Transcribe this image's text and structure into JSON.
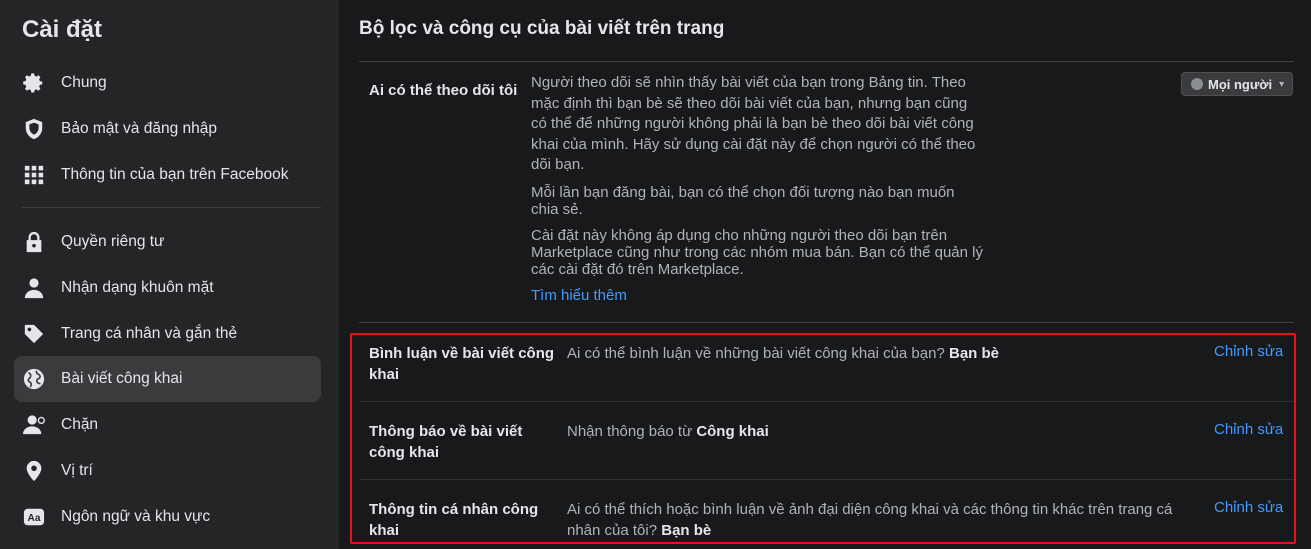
{
  "sidebar": {
    "title": "Cài đặt",
    "items": [
      {
        "label": "Chung",
        "icon": "gear-icon"
      },
      {
        "label": "Bảo mật và đăng nhập",
        "icon": "shield-icon"
      },
      {
        "label": "Thông tin của bạn trên Facebook",
        "icon": "grid-icon"
      },
      {
        "label": "Quyền riêng tư",
        "icon": "lock-icon"
      },
      {
        "label": "Nhận dạng khuôn mặt",
        "icon": "person-icon"
      },
      {
        "label": "Trang cá nhân và gắn thẻ",
        "icon": "tag-icon"
      },
      {
        "label": "Bài viết công khai",
        "icon": "globe-icon",
        "active": true
      },
      {
        "label": "Chặn",
        "icon": "block-person-icon"
      },
      {
        "label": "Vị trí",
        "icon": "location-pin-icon"
      },
      {
        "label": "Ngôn ngữ và khu vực",
        "icon": "language-icon"
      }
    ]
  },
  "main": {
    "title": "Bộ lọc và công cụ của bài viết trên trang",
    "follow": {
      "label": "Ai có thể theo dõi tôi",
      "para1": "Người theo dõi sẽ nhìn thấy bài viết của bạn trong Bảng tin. Theo mặc định thì bạn bè sẽ theo dõi bài viết của bạn, nhưng bạn cũng có thể để những người không phải là bạn bè theo dõi bài viết công khai của mình. Hãy sử dụng cài đặt này để chọn người có thể theo dõi bạn.",
      "para2": "Mỗi lần bạn đăng bài, bạn có thể chọn đối tượng nào bạn muốn chia sẻ.",
      "para3": "Cài đặt này không áp dụng cho những người theo dõi bạn trên Marketplace cũng như trong các nhóm mua bán. Bạn có thể quản lý các cài đặt đó trên Marketplace.",
      "learn_more": "Tìm hiểu thêm",
      "audience": "Mọi người"
    },
    "rows": [
      {
        "label": "Bình luận về bài viết công khai",
        "desc": "Ai có thể bình luận về những bài viết công khai của bạn? ",
        "value": "Bạn bè",
        "edit": "Chỉnh sửa"
      },
      {
        "label": "Thông báo về bài viết công khai",
        "desc": "Nhận thông báo từ ",
        "value": "Công khai",
        "edit": "Chỉnh sửa"
      },
      {
        "label": "Thông tin cá nhân công khai",
        "desc": "Ai có thể thích hoặc bình luận về ảnh đại diện công khai và các thông tin khác trên trang cá nhân của tôi? ",
        "value": "Bạn bè",
        "edit": "Chỉnh sửa"
      }
    ]
  },
  "colors": {
    "accent": "#4599ff",
    "highlight_border": "#e3141c",
    "background": "#18191a",
    "sidebar": "#242526"
  }
}
